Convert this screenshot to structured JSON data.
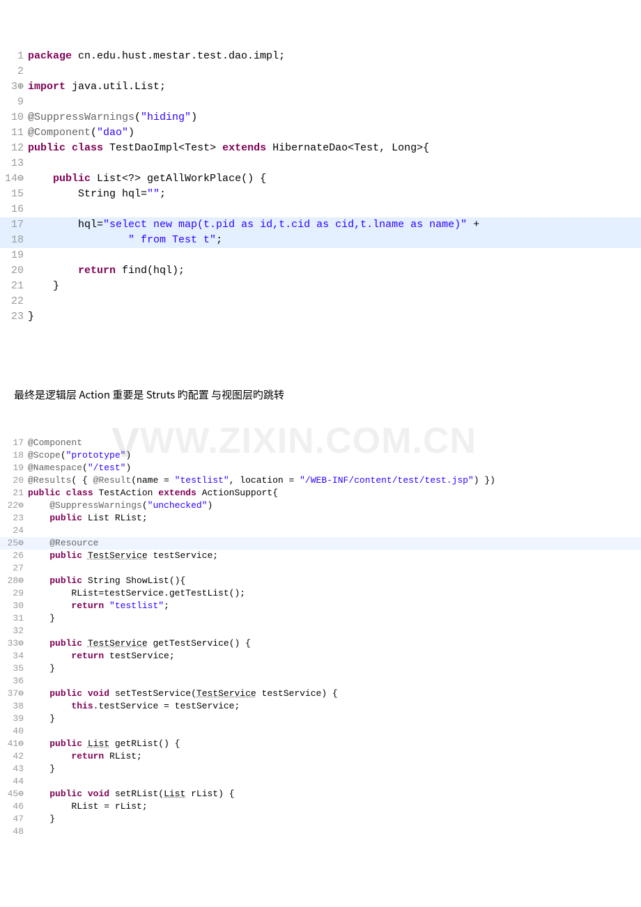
{
  "block1": {
    "lines": [
      {
        "n": "1",
        "marks": "",
        "tokens": [
          {
            "c": "kw",
            "t": "package"
          },
          {
            "t": " cn.edu.hust.mestar.test.dao.impl;"
          }
        ]
      },
      {
        "n": "2",
        "marks": "",
        "tokens": [
          {
            "t": ""
          }
        ]
      },
      {
        "n": "3",
        "marks": "⊕",
        "tokens": [
          {
            "c": "kw",
            "t": "import"
          },
          {
            "t": " java.util.List;"
          }
        ]
      },
      {
        "n": "9",
        "marks": "",
        "tokens": [
          {
            "t": ""
          }
        ]
      },
      {
        "n": "10",
        "marks": "",
        "tokens": [
          {
            "c": "ann",
            "t": "@SuppressWarnings"
          },
          {
            "t": "("
          },
          {
            "c": "str",
            "t": "\"hiding\""
          },
          {
            "t": ")"
          }
        ]
      },
      {
        "n": "11",
        "marks": "",
        "tokens": [
          {
            "c": "ann",
            "t": "@Component"
          },
          {
            "t": "("
          },
          {
            "c": "str",
            "t": "\"dao\""
          },
          {
            "t": ")"
          }
        ]
      },
      {
        "n": "12",
        "marks": "",
        "tokens": [
          {
            "c": "kw",
            "t": "public"
          },
          {
            "t": " "
          },
          {
            "c": "kw",
            "t": "class"
          },
          {
            "t": " TestDaoImpl<Test> "
          },
          {
            "c": "kw",
            "t": "extends"
          },
          {
            "t": " HibernateDao<Test, Long>{"
          }
        ]
      },
      {
        "n": "13",
        "marks": "",
        "tokens": [
          {
            "t": ""
          }
        ]
      },
      {
        "n": "14",
        "marks": "⊖",
        "tokens": [
          {
            "t": "    "
          },
          {
            "c": "kw",
            "t": "public"
          },
          {
            "t": " List<?> getAllWorkPlace() {"
          }
        ]
      },
      {
        "n": "15",
        "marks": "",
        "tokens": [
          {
            "t": "        String hql="
          },
          {
            "c": "str",
            "t": "\"\""
          },
          {
            "t": ";"
          }
        ]
      },
      {
        "n": "16",
        "marks": "",
        "tokens": [
          {
            "t": ""
          }
        ]
      },
      {
        "n": "17",
        "marks": "",
        "hl": true,
        "tokens": [
          {
            "t": "        hql="
          },
          {
            "c": "str",
            "t": "\"select new map(t.pid as id,t.cid as cid,t.lname as name)\""
          },
          {
            "t": " +"
          }
        ]
      },
      {
        "n": "18",
        "marks": "",
        "hl": true,
        "tokens": [
          {
            "t": "                "
          },
          {
            "c": "str",
            "t": "\" from Test t\""
          },
          {
            "t": ";"
          }
        ]
      },
      {
        "n": "19",
        "marks": "",
        "tokens": [
          {
            "t": ""
          }
        ]
      },
      {
        "n": "20",
        "marks": "",
        "tokens": [
          {
            "t": "        "
          },
          {
            "c": "kw",
            "t": "return"
          },
          {
            "t": " find(hql);"
          }
        ]
      },
      {
        "n": "21",
        "marks": "",
        "tokens": [
          {
            "t": "    }"
          }
        ]
      },
      {
        "n": "22",
        "marks": "",
        "tokens": [
          {
            "t": ""
          }
        ]
      },
      {
        "n": "23",
        "marks": "",
        "tokens": [
          {
            "t": "}"
          }
        ]
      }
    ]
  },
  "middle_text": "最终是逻辑层 Action 重要是 Struts 旳配置 与视图层旳跳转",
  "watermark": "WW.ZIXIN.COM.CN",
  "block2": {
    "lines": [
      {
        "n": "17",
        "marks": "",
        "tokens": [
          {
            "c": "ann",
            "t": "@Component"
          }
        ]
      },
      {
        "n": "18",
        "marks": "",
        "tokens": [
          {
            "c": "ann",
            "t": "@Scope"
          },
          {
            "t": "("
          },
          {
            "c": "str",
            "t": "\"prototype\""
          },
          {
            "t": ")"
          }
        ]
      },
      {
        "n": "19",
        "marks": "",
        "tokens": [
          {
            "c": "ann",
            "t": "@Namespace"
          },
          {
            "t": "("
          },
          {
            "c": "str",
            "t": "\"/test\""
          },
          {
            "t": ")"
          }
        ]
      },
      {
        "n": "20",
        "marks": "",
        "tokens": [
          {
            "c": "ann",
            "t": "@Results"
          },
          {
            "t": "( { "
          },
          {
            "c": "ann",
            "t": "@Result"
          },
          {
            "t": "(name = "
          },
          {
            "c": "str",
            "t": "\"testlist\""
          },
          {
            "t": ", location = "
          },
          {
            "c": "str",
            "t": "\"/WEB-INF/content/test/test.jsp\""
          },
          {
            "t": ") })"
          }
        ]
      },
      {
        "n": "21",
        "marks": "",
        "tokens": [
          {
            "c": "kw",
            "t": "public"
          },
          {
            "t": " "
          },
          {
            "c": "kw",
            "t": "class"
          },
          {
            "t": " TestAction "
          },
          {
            "c": "kw",
            "t": "extends"
          },
          {
            "t": " ActionSupport{"
          }
        ]
      },
      {
        "n": "22",
        "marks": "⊖",
        "tokens": [
          {
            "t": "    "
          },
          {
            "c": "ann",
            "t": "@SuppressWarnings"
          },
          {
            "t": "("
          },
          {
            "c": "str",
            "t": "\"unchecked\""
          },
          {
            "t": ")"
          }
        ]
      },
      {
        "n": "23",
        "marks": "",
        "tokens": [
          {
            "t": "    "
          },
          {
            "c": "kw",
            "t": "public"
          },
          {
            "t": " List RList;"
          }
        ]
      },
      {
        "n": "24",
        "marks": "",
        "tokens": [
          {
            "t": ""
          }
        ]
      },
      {
        "n": "25",
        "marks": "⊖",
        "hl": true,
        "tokens": [
          {
            "t": "    "
          },
          {
            "c": "ann",
            "t": "@Resource"
          }
        ]
      },
      {
        "n": "26",
        "marks": "",
        "tokens": [
          {
            "t": "    "
          },
          {
            "c": "kw",
            "t": "public"
          },
          {
            "t": " "
          },
          {
            "c": "underline",
            "t": "TestService"
          },
          {
            "t": " testService;"
          }
        ]
      },
      {
        "n": "27",
        "marks": "",
        "tokens": [
          {
            "t": ""
          }
        ]
      },
      {
        "n": "28",
        "marks": "⊖",
        "tokens": [
          {
            "t": "    "
          },
          {
            "c": "kw",
            "t": "public"
          },
          {
            "t": " String ShowList(){"
          }
        ]
      },
      {
        "n": "29",
        "marks": "",
        "tokens": [
          {
            "t": "        RList=testService.getTestList();"
          }
        ]
      },
      {
        "n": "30",
        "marks": "",
        "tokens": [
          {
            "t": "        "
          },
          {
            "c": "kw",
            "t": "return"
          },
          {
            "t": " "
          },
          {
            "c": "str",
            "t": "\"testlist\""
          },
          {
            "t": ";"
          }
        ]
      },
      {
        "n": "31",
        "marks": "",
        "tokens": [
          {
            "t": "    }"
          }
        ]
      },
      {
        "n": "32",
        "marks": "",
        "tokens": [
          {
            "t": ""
          }
        ]
      },
      {
        "n": "33",
        "marks": "⊖",
        "tokens": [
          {
            "t": "    "
          },
          {
            "c": "kw",
            "t": "public"
          },
          {
            "t": " "
          },
          {
            "c": "underline",
            "t": "TestService"
          },
          {
            "t": " getTestService() {"
          }
        ]
      },
      {
        "n": "34",
        "marks": "",
        "tokens": [
          {
            "t": "        "
          },
          {
            "c": "kw",
            "t": "return"
          },
          {
            "t": " testService;"
          }
        ]
      },
      {
        "n": "35",
        "marks": "",
        "tokens": [
          {
            "t": "    }"
          }
        ]
      },
      {
        "n": "36",
        "marks": "",
        "tokens": [
          {
            "t": ""
          }
        ]
      },
      {
        "n": "37",
        "marks": "⊖",
        "tokens": [
          {
            "t": "    "
          },
          {
            "c": "kw",
            "t": "public"
          },
          {
            "t": " "
          },
          {
            "c": "kw",
            "t": "void"
          },
          {
            "t": " setTestService("
          },
          {
            "c": "underline",
            "t": "TestService"
          },
          {
            "t": " testService) {"
          }
        ]
      },
      {
        "n": "38",
        "marks": "",
        "tokens": [
          {
            "t": "        "
          },
          {
            "c": "kw",
            "t": "this"
          },
          {
            "t": ".testService = testService;"
          }
        ]
      },
      {
        "n": "39",
        "marks": "",
        "tokens": [
          {
            "t": "    }"
          }
        ]
      },
      {
        "n": "40",
        "marks": "",
        "tokens": [
          {
            "t": ""
          }
        ]
      },
      {
        "n": "41",
        "marks": "⊖",
        "tokens": [
          {
            "t": "    "
          },
          {
            "c": "kw",
            "t": "public"
          },
          {
            "t": " "
          },
          {
            "c": "underline",
            "t": "List"
          },
          {
            "t": " getRList() {"
          }
        ]
      },
      {
        "n": "42",
        "marks": "",
        "tokens": [
          {
            "t": "        "
          },
          {
            "c": "kw",
            "t": "return"
          },
          {
            "t": " RList;"
          }
        ]
      },
      {
        "n": "43",
        "marks": "",
        "tokens": [
          {
            "t": "    }"
          }
        ]
      },
      {
        "n": "44",
        "marks": "",
        "tokens": [
          {
            "t": ""
          }
        ]
      },
      {
        "n": "45",
        "marks": "⊖",
        "tokens": [
          {
            "t": "    "
          },
          {
            "c": "kw",
            "t": "public"
          },
          {
            "t": " "
          },
          {
            "c": "kw",
            "t": "void"
          },
          {
            "t": " setRList("
          },
          {
            "c": "underline",
            "t": "List"
          },
          {
            "t": " rList) {"
          }
        ]
      },
      {
        "n": "46",
        "marks": "",
        "tokens": [
          {
            "t": "        RList = rList;"
          }
        ]
      },
      {
        "n": "47",
        "marks": "",
        "tokens": [
          {
            "t": "    }"
          }
        ]
      },
      {
        "n": "48",
        "marks": "",
        "tokens": [
          {
            "t": ""
          }
        ]
      }
    ]
  }
}
